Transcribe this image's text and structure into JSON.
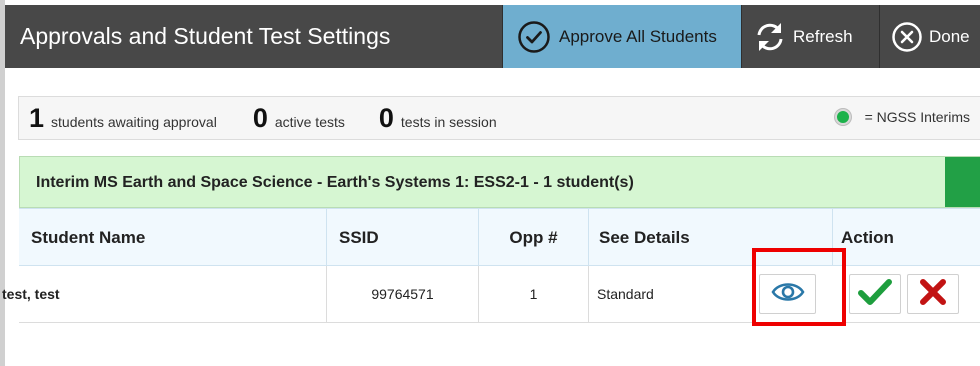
{
  "header": {
    "title": "Approvals and Student Test Settings",
    "approve_all_label": "Approve All Students",
    "refresh_label": "Refresh",
    "done_label": "Done"
  },
  "summary": {
    "awaiting_count": "1",
    "awaiting_label": "students awaiting approval",
    "active_count": "0",
    "active_label": "active tests",
    "session_count": "0",
    "session_label": "tests in session",
    "legend_label": "= NGSS Interims",
    "legend_color": "#1cb24b"
  },
  "group": {
    "title": "Interim MS Earth and Space Science - Earth's Systems 1: ESS2-1 - 1 student(s)",
    "stripe_color": "#22a046"
  },
  "table": {
    "columns": [
      "Student Name",
      "SSID",
      "Opp #",
      "See Details",
      "Action"
    ],
    "rows": [
      {
        "name": "test, test",
        "ssid": "99764571",
        "opp": "1",
        "details": "Standard"
      }
    ]
  },
  "icons": {
    "approve_all": "check-circle-icon",
    "refresh": "refresh-icon",
    "done": "close-circle-icon",
    "view": "eye-icon",
    "approve": "checkmark-icon",
    "deny": "x-icon"
  },
  "colors": {
    "header_bg": "#484848",
    "approve_all_bg": "#6faecf",
    "group_bg": "#d6f6d2",
    "approve_green": "#1e9e3e",
    "deny_red": "#c21313",
    "view_blue": "#2a78a8",
    "highlight_red": "#ee0000"
  }
}
